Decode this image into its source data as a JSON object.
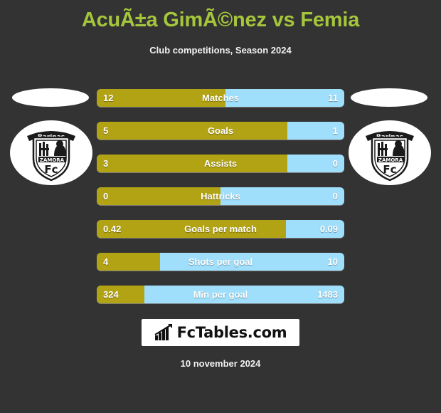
{
  "header": {
    "title": "AcuÃ±a GimÃ©nez vs Femia",
    "subtitle": "Club competitions, Season 2024",
    "title_color": "#a5c63b"
  },
  "crests": {
    "left": {
      "club_name": "Zamora FC",
      "banner_text": "Barinas",
      "shield_text": "ZAMORA",
      "badge_text": "Fc",
      "icon": "zamora-fc-crest"
    },
    "right": {
      "club_name": "Zamora FC",
      "banner_text": "Barinas",
      "shield_text": "ZAMORA",
      "badge_text": "Fc",
      "icon": "zamora-fc-crest"
    }
  },
  "colors": {
    "home_bar": "#b2a314",
    "away_bar": "#9fdffb",
    "background": "#333333",
    "text": "#ffffff"
  },
  "chart_data": {
    "type": "bar",
    "title": "AcuÃ±a GimÃ©nez vs Femia",
    "subtitle": "Club competitions, Season 2024",
    "xlabel": "",
    "ylabel": "",
    "orientation": "horizontal-diverging",
    "legend_position": "none",
    "grid": false,
    "categories": [
      "Matches",
      "Goals",
      "Assists",
      "Hattricks",
      "Goals per match",
      "Shots per goal",
      "Min per goal"
    ],
    "series": [
      {
        "name": "AcuÃ±a GimÃ©nez",
        "color": "#b2a314",
        "values": [
          "12",
          "5",
          "3",
          "0",
          "0.42",
          "4",
          "324"
        ],
        "fill_percents": [
          52,
          77,
          77,
          50,
          76.5,
          25.6,
          19.3
        ]
      },
      {
        "name": "Femia",
        "color": "#9fdffb",
        "values": [
          "11",
          "1",
          "0",
          "0",
          "0.09",
          "10",
          "1483"
        ],
        "fill_percents": [
          48,
          23,
          23,
          50,
          23.5,
          74.4,
          80.7
        ]
      }
    ]
  },
  "stats": [
    {
      "label": "Matches",
      "home": "12",
      "away": "11",
      "home_pct": 52
    },
    {
      "label": "Goals",
      "home": "5",
      "away": "1",
      "home_pct": 77
    },
    {
      "label": "Assists",
      "home": "3",
      "away": "0",
      "home_pct": 77
    },
    {
      "label": "Hattricks",
      "home": "0",
      "away": "0",
      "home_pct": 50
    },
    {
      "label": "Goals per match",
      "home": "0.42",
      "away": "0.09",
      "home_pct": 76.5
    },
    {
      "label": "Shots per goal",
      "home": "4",
      "away": "10",
      "home_pct": 25.6
    },
    {
      "label": "Min per goal",
      "home": "324",
      "away": "1483",
      "home_pct": 19.3
    }
  ],
  "footer": {
    "brand_text": "FcTables.com",
    "brand_icon": "bar-chart-growth-icon",
    "date": "10 november 2024"
  }
}
